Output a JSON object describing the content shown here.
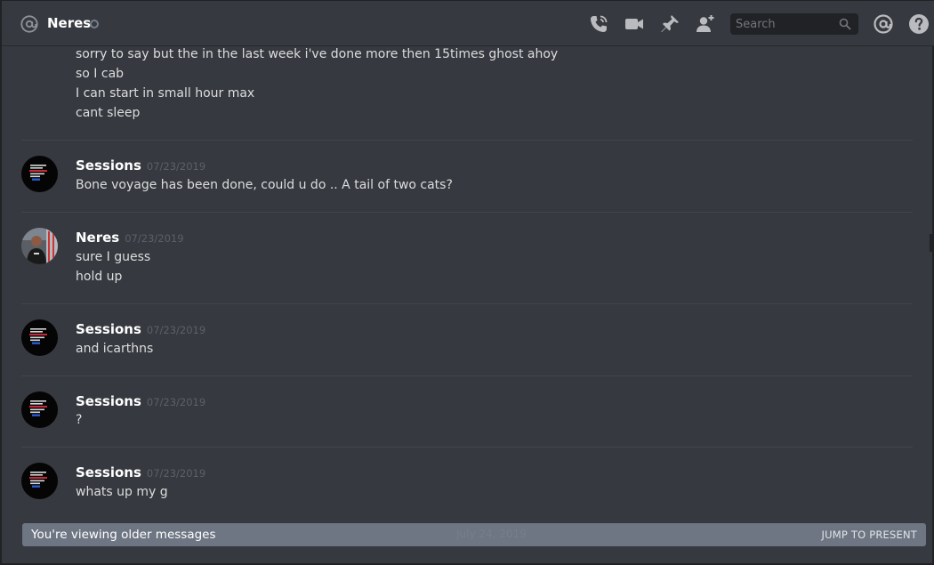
{
  "header": {
    "channel_name": "Neres",
    "search_placeholder": "Search",
    "icons": [
      "at-icon",
      "status-icon",
      "phone-call-icon",
      "video-icon",
      "pin-icon",
      "add-friend-icon",
      "search-icon",
      "mention-icon",
      "help-icon"
    ]
  },
  "messages": {
    "continued": {
      "lines": [
        "sorry to say but the in the last week i've done more then 15times ghost ahoy",
        "so I cab",
        "I can start in small hour max",
        "cant sleep"
      ]
    },
    "groups": [
      {
        "author": "Sessions",
        "timestamp": "07/23/2019",
        "lines": [
          "Bone voyage has been done, could u do .. A tail of two cats?"
        ]
      },
      {
        "author": "Neres",
        "timestamp": "07/23/2019",
        "lines": [
          "sure I guess",
          "hold up"
        ]
      },
      {
        "author": "Sessions",
        "timestamp": "07/23/2019",
        "lines": [
          "and icarthns"
        ]
      },
      {
        "author": "Sessions",
        "timestamp": "07/23/2019",
        "lines": [
          "?"
        ]
      },
      {
        "author": "Sessions",
        "timestamp": "07/23/2019",
        "lines": [
          "whats up my g"
        ]
      }
    ]
  },
  "older_bar": {
    "text": "You're viewing older messages",
    "jump_label": "JUMP TO PRESENT",
    "ghost_date": "July 24, 2019"
  },
  "colors": {
    "background": "#36393f",
    "header_text": "#ffffff",
    "message_text": "#dcddde",
    "timestamp": "#5c6067",
    "older_bar": "#6e7683"
  }
}
